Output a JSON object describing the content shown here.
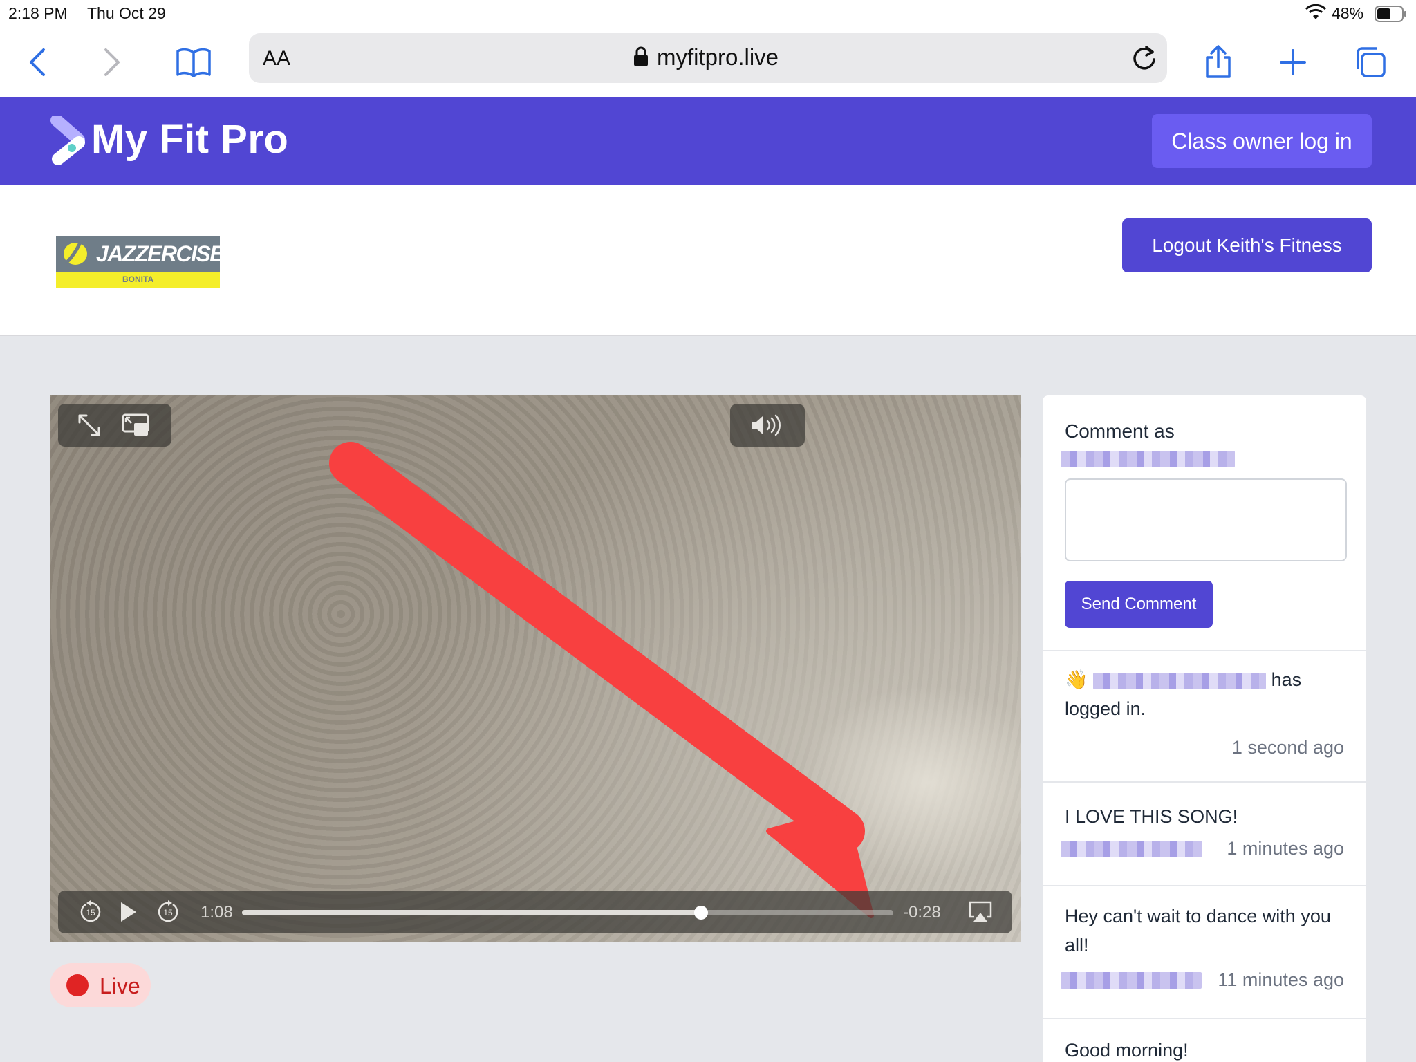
{
  "status_bar": {
    "time": "2:18 PM",
    "date": "Thu Oct 29",
    "battery": "48%"
  },
  "browser": {
    "text_size_label": "AA",
    "url": "myfitpro.live"
  },
  "site": {
    "brand": "My Fit Pro",
    "owner_login_label": "Class owner log in"
  },
  "class_header": {
    "logo_text": "JAZZERCISE",
    "logo_subtext": "BONITA",
    "logout_label": "Logout Keith's Fitness"
  },
  "video": {
    "elapsed": "1:08",
    "remaining": "-0:28",
    "progress": 0.705
  },
  "live_badge": {
    "label": "Live"
  },
  "comments": {
    "comment_as_label": "Comment as",
    "send_label": "Send Comment",
    "items": [
      {
        "emoji": "👋",
        "text_tail": "has",
        "text_line2": "logged in.",
        "time": "1 second ago"
      },
      {
        "text": "I LOVE THIS SONG!",
        "time": "1 minutes ago"
      },
      {
        "text": "Hey can't wait to dance with you all!",
        "time": "11 minutes ago"
      },
      {
        "text": "Good morning!"
      }
    ]
  },
  "colors": {
    "brand": "#5146d3",
    "accent_button": "#6a5cf1",
    "live_red": "#e02424",
    "arrow_red": "#f84040"
  }
}
